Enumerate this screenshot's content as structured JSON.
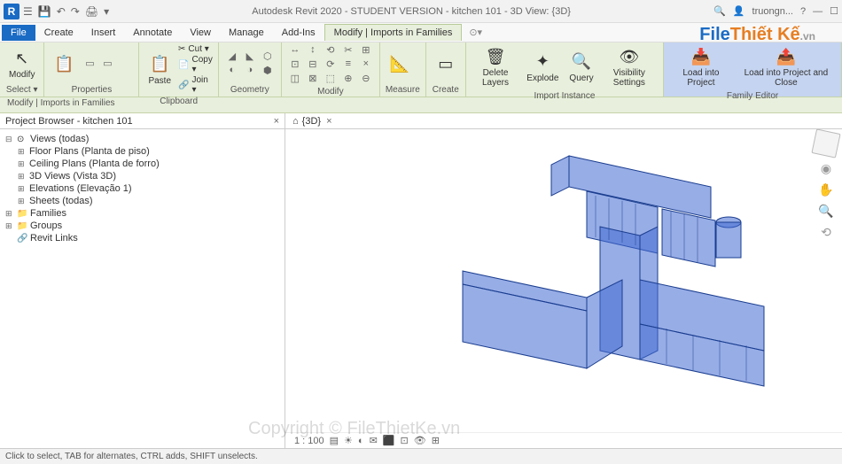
{
  "title": "Autodesk Revit 2020 - STUDENT VERSION - kitchen 101 - 3D View: {3D}",
  "user": "truongn...",
  "menu": {
    "file": "File",
    "tabs": [
      "Create",
      "Insert",
      "Annotate",
      "View",
      "Manage",
      "Add-Ins",
      "Modify | Imports in Families"
    ]
  },
  "ribbon": {
    "select": {
      "modify": "Modify",
      "label": "Select ▾"
    },
    "properties": {
      "label": "Properties"
    },
    "clipboard": {
      "paste": "Paste",
      "cut": "Cut ▾",
      "copy": "Copy ▾",
      "join": "Join ▾",
      "label": "Clipboard"
    },
    "geometry": {
      "label": "Geometry"
    },
    "modify": {
      "label": "Modify"
    },
    "measure": {
      "label": "Measure"
    },
    "create": {
      "label": "Create"
    },
    "import": {
      "delete": "Delete\nLayers",
      "explode": "Explode",
      "query": "Query",
      "visibility": "Visibility\nSettings",
      "label": "Import Instance"
    },
    "family": {
      "loadProject": "Load into\nProject",
      "loadClose": "Load into\nProject and Close",
      "label": "Family Editor"
    }
  },
  "contextBar": "Modify | Imports in Families",
  "browser": {
    "title": "Project Browser - kitchen 101",
    "root": "Views (todas)",
    "items": [
      "Floor Plans (Planta de piso)",
      "Ceiling Plans (Planta de forro)",
      "3D Views (Vista 3D)",
      "Elevations (Elevação 1)",
      "Sheets (todas)"
    ],
    "families": "Families",
    "groups": "Groups",
    "revitLinks": "Revit Links"
  },
  "viewTab": "{3D}",
  "scale": "1 : 100",
  "status": "Click to select, TAB for alternates, CTRL adds, SHIFT unselects.",
  "watermark": {
    "logo1": "File",
    "logo2": "Thiết Kế",
    "logo3": ".vn",
    "center": "Copyright © FileThietKe.vn"
  }
}
